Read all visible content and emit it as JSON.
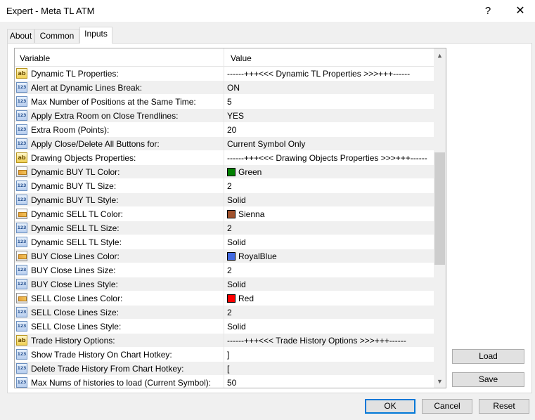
{
  "window": {
    "title": "Expert - Meta TL ATM",
    "help": "?",
    "close": "✕"
  },
  "tabs": [
    {
      "label": "About"
    },
    {
      "label": "Common"
    },
    {
      "label": "Inputs"
    }
  ],
  "grid": {
    "col_variable": "Variable",
    "col_value": "Value",
    "scroll_up": "▲",
    "scroll_down": "▼",
    "rows": [
      {
        "type": "ab",
        "name": "Dynamic TL Properties:",
        "value": "------+++<<< Dynamic TL Properties >>>+++------"
      },
      {
        "type": "123",
        "name": "Alert at Dynamic Lines Break:",
        "value": "ON"
      },
      {
        "type": "123",
        "name": "Max Number of Positions at the Same Time:",
        "value": "5"
      },
      {
        "type": "123",
        "name": "Apply Extra Room on Close Trendlines:",
        "value": "YES"
      },
      {
        "type": "123",
        "name": "Extra Room (Points):",
        "value": "20"
      },
      {
        "type": "123",
        "name": "Apply Close/Delete All Buttons for:",
        "value": "Current Symbol Only"
      },
      {
        "type": "ab",
        "name": "Drawing Objects Properties:",
        "value": "------+++<<< Drawing Objects Properties >>>+++------"
      },
      {
        "type": "color",
        "name": "Dynamic BUY TL Color:",
        "value": "Green",
        "swatch": "#008000"
      },
      {
        "type": "123",
        "name": "Dynamic BUY TL Size:",
        "value": "2"
      },
      {
        "type": "123",
        "name": "Dynamic BUY TL Style:",
        "value": "Solid"
      },
      {
        "type": "color",
        "name": "Dynamic SELL TL Color:",
        "value": "Sienna",
        "swatch": "#a0522d"
      },
      {
        "type": "123",
        "name": "Dynamic SELL TL Size:",
        "value": "2"
      },
      {
        "type": "123",
        "name": "Dynamic SELL TL Style:",
        "value": "Solid"
      },
      {
        "type": "color",
        "name": "BUY Close Lines Color:",
        "value": "RoyalBlue",
        "swatch": "#4169e1"
      },
      {
        "type": "123",
        "name": "BUY Close Lines Size:",
        "value": "2"
      },
      {
        "type": "123",
        "name": "BUY Close Lines Style:",
        "value": "Solid"
      },
      {
        "type": "color",
        "name": "SELL Close Lines Color:",
        "value": "Red",
        "swatch": "#ff0000"
      },
      {
        "type": "123",
        "name": "SELL Close Lines Size:",
        "value": "2"
      },
      {
        "type": "123",
        "name": "SELL Close Lines Style:",
        "value": "Solid"
      },
      {
        "type": "ab",
        "name": "Trade History Options:",
        "value": "------+++<<< Trade History Options >>>+++------"
      },
      {
        "type": "123",
        "name": "Show Trade History On Chart Hotkey:",
        "value": "]"
      },
      {
        "type": "123",
        "name": "Delete Trade History From Chart Hotkey:",
        "value": "["
      },
      {
        "type": "123",
        "name": "Max Nums of histories to load (Current Symbol):",
        "value": "50"
      }
    ]
  },
  "buttons": {
    "load": "Load",
    "save": "Save",
    "ok": "OK",
    "cancel": "Cancel",
    "reset": "Reset"
  }
}
